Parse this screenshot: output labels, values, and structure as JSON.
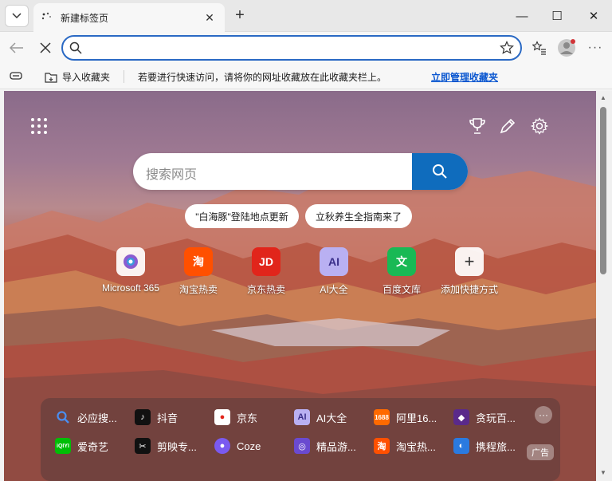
{
  "tab": {
    "title": "新建标签页"
  },
  "address": {
    "value": "",
    "placeholder": ""
  },
  "favorites": {
    "import_label": "导入收藏夹",
    "hint": "若要进行快速访问，请将你的网址收藏放在此收藏夹栏上。",
    "manage_link": "立即管理收藏夹"
  },
  "search": {
    "placeholder": "搜索网页"
  },
  "trending": [
    {
      "label": "\"白海豚\"登陆地点更新"
    },
    {
      "label": "立秋养生全指南来了"
    }
  ],
  "quick_links": [
    {
      "label": "Microsoft 365",
      "icon": "microsoft365-icon"
    },
    {
      "label": "淘宝热卖",
      "icon": "taobao-icon"
    },
    {
      "label": "京东热卖",
      "icon": "jd-icon"
    },
    {
      "label": "AI大全",
      "icon": "ai-icon"
    },
    {
      "label": "百度文库",
      "icon": "wenku-icon"
    },
    {
      "label": "添加快捷方式",
      "icon": "plus-icon"
    }
  ],
  "dock": {
    "row1": [
      {
        "label": "必应搜...",
        "icon": "bing-search-icon"
      },
      {
        "label": "抖音",
        "icon": "douyin-icon"
      },
      {
        "label": "京东",
        "icon": "jd-icon"
      },
      {
        "label": "AI大全",
        "icon": "ai-icon"
      },
      {
        "label": "阿里16...",
        "icon": "1688-icon"
      },
      {
        "label": "贪玩百...",
        "icon": "game-icon"
      }
    ],
    "row2": [
      {
        "label": "爱奇艺",
        "icon": "iqiyi-icon"
      },
      {
        "label": "剪映专...",
        "icon": "capcut-icon"
      },
      {
        "label": "Coze",
        "icon": "coze-icon"
      },
      {
        "label": "精品游...",
        "icon": "gamepad-icon"
      },
      {
        "label": "淘宝热...",
        "icon": "taobao-icon"
      },
      {
        "label": "携程旅...",
        "icon": "ctrip-icon"
      }
    ],
    "more": "···",
    "ad": "广告"
  },
  "colors": {
    "accent": "#0f6cbd",
    "address_border": "#2a69c4"
  }
}
